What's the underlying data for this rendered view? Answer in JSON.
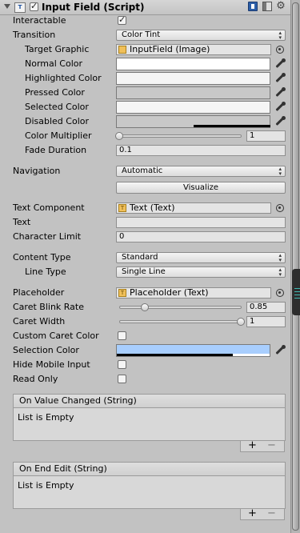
{
  "component": {
    "title": "Input Field (Script)",
    "enabled": true
  },
  "properties": {
    "interactable": {
      "label": "Interactable",
      "checked": true
    },
    "transition": {
      "label": "Transition",
      "value": "Color Tint"
    },
    "target_graphic": {
      "label": "Target Graphic",
      "value": "InputField (Image)"
    },
    "normal_color": {
      "label": "Normal Color"
    },
    "highlighted_color": {
      "label": "Highlighted Color"
    },
    "pressed_color": {
      "label": "Pressed Color"
    },
    "selected_color": {
      "label": "Selected Color"
    },
    "disabled_color": {
      "label": "Disabled Color"
    },
    "color_multiplier": {
      "label": "Color Multiplier",
      "value": "1"
    },
    "fade_duration": {
      "label": "Fade Duration",
      "value": "0.1"
    },
    "navigation": {
      "label": "Navigation",
      "value": "Automatic"
    },
    "visualize": {
      "label": "Visualize"
    },
    "text_component": {
      "label": "Text Component",
      "value": "Text (Text)"
    },
    "text": {
      "label": "Text",
      "value": ""
    },
    "character_limit": {
      "label": "Character Limit",
      "value": "0"
    },
    "content_type": {
      "label": "Content Type",
      "value": "Standard"
    },
    "line_type": {
      "label": "Line Type",
      "value": "Single Line"
    },
    "placeholder": {
      "label": "Placeholder",
      "value": "Placeholder (Text)"
    },
    "caret_blink_rate": {
      "label": "Caret Blink Rate",
      "value": "0.85"
    },
    "caret_width": {
      "label": "Caret Width",
      "value": "1"
    },
    "custom_caret_color": {
      "label": "Custom Caret Color",
      "checked": false
    },
    "selection_color": {
      "label": "Selection Color",
      "color": "#a8cefe"
    },
    "hide_mobile_input": {
      "label": "Hide Mobile Input",
      "checked": false
    },
    "read_only": {
      "label": "Read Only",
      "checked": false
    }
  },
  "events": [
    {
      "header": "On Value Changed (String)",
      "body": "List is Empty",
      "add": "+",
      "remove": "−"
    },
    {
      "header": "On End Edit (String)",
      "body": "List is Empty",
      "add": "+",
      "remove": "−"
    }
  ],
  "icons": {
    "header": [
      "fold-arrow-icon",
      "script-icon",
      "enabled-checkbox",
      "help-book-icon",
      "preset-icon",
      "gear-icon"
    ],
    "object_picker": "object-picker-icon",
    "color_picker": "eyedropper-icon"
  }
}
